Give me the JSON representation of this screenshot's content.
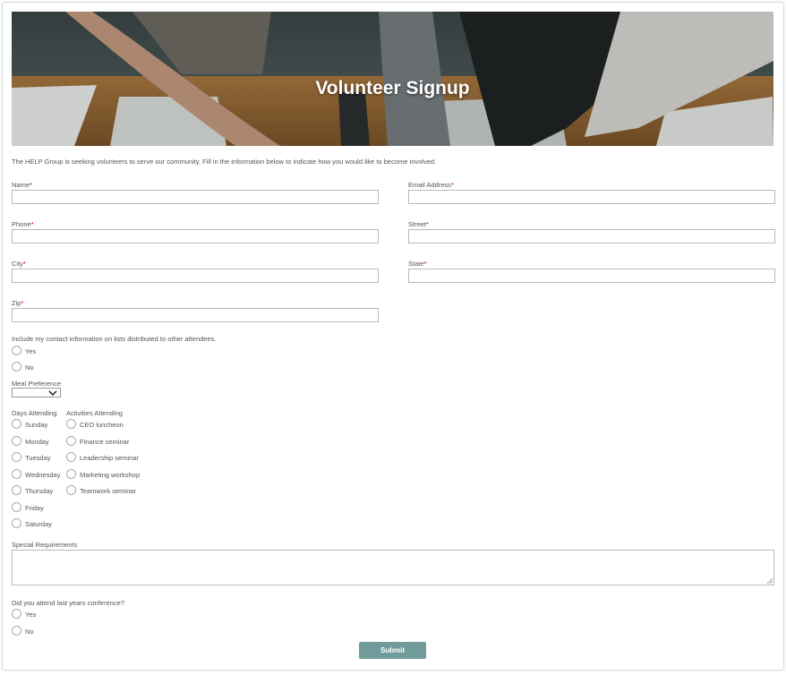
{
  "banner": {
    "title": "Volunteer Signup"
  },
  "intro": "The HELP Group is seeking volunteers to serve our community. Fill in the information below to indicate how you would like to become involved.",
  "fields": {
    "name": "Name",
    "email": "Email Address",
    "phone": "Phone",
    "street": "Street",
    "city": "City",
    "state": "State",
    "zip": "Zip",
    "required_mark": "*"
  },
  "contact_share": {
    "question": "Include my contact information on lists distributed to other attendees.",
    "yes": "Yes",
    "no": "No"
  },
  "meal": {
    "label": "Meal Preference",
    "selected": ""
  },
  "days": {
    "label": "Days Attending",
    "options": [
      "Sunday",
      "Monday",
      "Tuesday",
      "Wednesday",
      "Thursday",
      "Friday",
      "Saturday"
    ]
  },
  "activities": {
    "label": "Activities Attending",
    "options": [
      "CEO luncheon",
      "Finance seminar",
      "Leadership seminar",
      "Marketing workshop",
      "Teamwork seminar"
    ]
  },
  "special": {
    "label": "Special Requirements"
  },
  "last_year": {
    "question": "Did you attend last years conference?",
    "yes": "Yes",
    "no": "No"
  },
  "submit": {
    "label": "Submit"
  },
  "colors": {
    "accent": "#6f9c9a",
    "required": "#cc0000",
    "border": "#b9b9b9"
  },
  "icons": {
    "select_arrow": "chevron-down-icon",
    "resize": "resize-grip-icon"
  }
}
